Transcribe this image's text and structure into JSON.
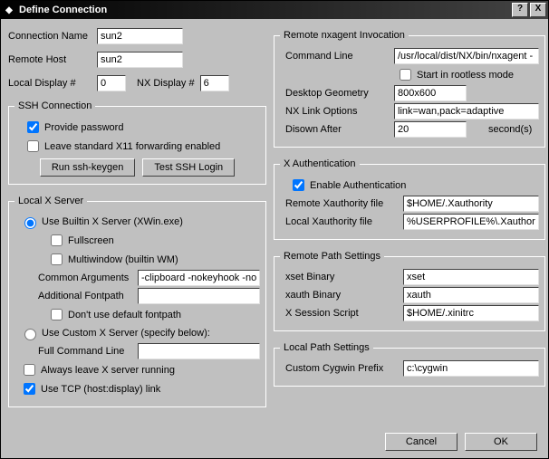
{
  "title": "Define Connection",
  "help": "?",
  "close": "X",
  "top": {
    "connName": {
      "label": "Connection Name",
      "value": "sun2"
    },
    "remoteHost": {
      "label": "Remote Host",
      "value": "sun2"
    },
    "localDisp": {
      "label": "Local Display #",
      "value": "0"
    },
    "nxDisp": {
      "label": "NX Display #",
      "value": "6"
    }
  },
  "ssh": {
    "legend": "SSH Connection",
    "provide": "Provide password",
    "leave": "Leave standard X11 forwarding enabled",
    "keygen": "Run ssh-keygen",
    "test": "Test SSH Login"
  },
  "lx": {
    "legend": "Local X Server",
    "builtin": "Use Builtin X Server (XWin.exe)",
    "fullscreen": "Fullscreen",
    "multiwin": "Multiwindow (builtin WM)",
    "commonArgs": {
      "label": "Common Arguments",
      "value": "-clipboard -nokeyhook -nowi"
    },
    "addFont": {
      "label": "Additional Fontpath",
      "value": ""
    },
    "noDefFont": "Don't use default fontpath",
    "custom": "Use Custom X Server (specify below):",
    "fullCmd": {
      "label": "Full Command Line",
      "value": ""
    },
    "always": "Always leave X server running",
    "tcp": "Use TCP (host:display) link"
  },
  "nx": {
    "legend": "Remote nxagent Invocation",
    "cmd": {
      "label": "Command Line",
      "value": "/usr/local/dist/NX/bin/nxagent -"
    },
    "rootless": "Start in rootless mode",
    "geom": {
      "label": "Desktop Geometry",
      "value": "800x600"
    },
    "link": {
      "label": "NX Link Options",
      "value": "link=wan,pack=adaptive"
    },
    "disown": {
      "label": "Disown After",
      "value": "20",
      "unit": "second(s)"
    }
  },
  "xa": {
    "legend": "X Authentication",
    "enable": "Enable Authentication",
    "remote": {
      "label": "Remote Xauthority file",
      "value": "$HOME/.Xauthority"
    },
    "local": {
      "label": "Local Xauthority file",
      "value": "%USERPROFILE%\\.Xauthorit"
    }
  },
  "rp": {
    "legend": "Remote Path Settings",
    "xset": {
      "label": "xset Binary",
      "value": "xset"
    },
    "xauth": {
      "label": "xauth Binary",
      "value": "xauth"
    },
    "sess": {
      "label": "X Session Script",
      "value": "$HOME/.xinitrc"
    }
  },
  "lp": {
    "legend": "Local Path Settings",
    "cyg": {
      "label": "Custom Cygwin Prefix",
      "value": "c:\\cygwin"
    }
  },
  "cancel": "Cancel",
  "ok": "OK"
}
